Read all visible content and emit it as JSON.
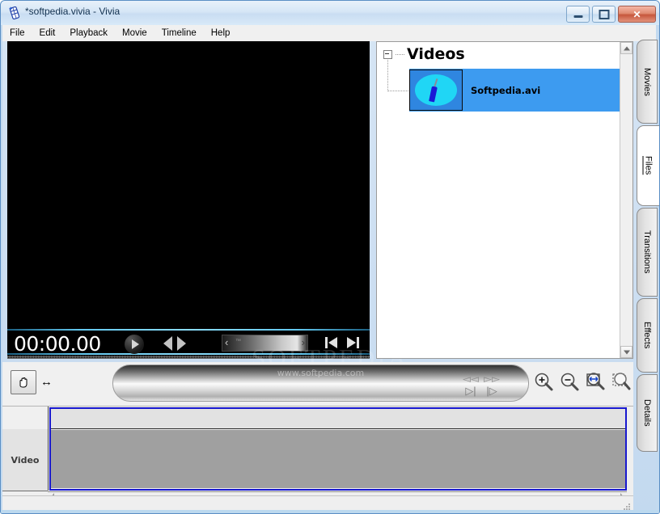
{
  "window": {
    "title": "*softpedia.vivia - Vivia",
    "app_icon": "film-strip-icon",
    "controls": {
      "minimize": "minimize-button",
      "maximize": "maximize-button",
      "close": "close-button",
      "close_glyph": "✕"
    }
  },
  "menubar": {
    "items": [
      {
        "label": "File"
      },
      {
        "label": "Edit"
      },
      {
        "label": "Playback"
      },
      {
        "label": "Movie"
      },
      {
        "label": "Timeline"
      },
      {
        "label": "Help"
      }
    ]
  },
  "preview": {
    "background_color": "#000000",
    "watermark": "SOFTPEDIA",
    "transport": {
      "timecode": "00:00.00",
      "play_label": "play-button",
      "step_back_label": "step-backward-button",
      "step_forward_label": "step-forward-button",
      "seek_left_arrow": "‹",
      "seek_right_arrow": "›",
      "seek_tm": "™",
      "jump_start_label": "jump-to-start-button",
      "jump_end_label": "jump-to-end-button",
      "accent_color": "#63c8ef"
    }
  },
  "files_panel": {
    "tree_root_label": "Videos",
    "items": [
      {
        "name": "Softpedia.avi",
        "selected": true,
        "selection_color": "#3d9bf0",
        "thumbnail": "video-clip-thumbnail"
      }
    ],
    "scrollbar": {
      "up_arrow": "scroll-up-arrow",
      "down_arrow": "scroll-down-arrow"
    }
  },
  "side_tabs": {
    "items": [
      {
        "label": "Movies",
        "active": false
      },
      {
        "label": "Files",
        "active": true
      },
      {
        "label": "Transitions",
        "active": false
      },
      {
        "label": "Effects",
        "active": false
      },
      {
        "label": "Details",
        "active": false
      }
    ]
  },
  "timeline_toolbar": {
    "hand_tool": "hand-tool-button",
    "resize_tool_glyph": "↔",
    "scrubber": {
      "watermark": "www.softpedia.com",
      "rewind_glyph": "◅◅",
      "forward_glyph": "▻▻",
      "mark_in_glyph": "▷|",
      "mark_out_glyph": "|▷"
    },
    "zoom_buttons": [
      {
        "name": "zoom-in-button",
        "glyph": "+"
      },
      {
        "name": "zoom-out-button",
        "glyph": "−"
      },
      {
        "name": "zoom-fit-button",
        "glyph": "↔"
      },
      {
        "name": "zoom-selection-button",
        "glyph": ""
      }
    ]
  },
  "timeline": {
    "tracks": [
      {
        "label": "Video",
        "clip_color": "#a0a0a0",
        "selected": true
      }
    ],
    "selection_border_color": "#1818cf",
    "ruler_label": ""
  },
  "statusbar": {
    "text": ""
  }
}
